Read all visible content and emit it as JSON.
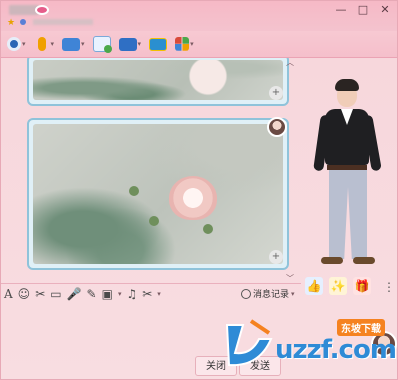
{
  "titlebar": {
    "controls": [
      "—",
      "□",
      "✕"
    ]
  },
  "toolbar": {
    "items": [
      {
        "icon": "record-icon",
        "color": "#2a66b5"
      },
      {
        "icon": "microphone-icon",
        "color": "#f0a000"
      },
      {
        "icon": "folder-icon",
        "color": "#3f84d6"
      },
      {
        "icon": "add-app-icon",
        "color": "#4aa84a"
      },
      {
        "icon": "screen-share-icon",
        "color": "#2f6fc4"
      },
      {
        "icon": "remote-desktop-icon",
        "color": "#2a8fd0"
      },
      {
        "icon": "apps-grid-icon",
        "color": "#d84a3a"
      }
    ]
  },
  "chat": {
    "zoom_glyph": "+"
  },
  "inputbar": {
    "icons": [
      "A",
      "☺",
      "✂",
      "▭",
      "🎤",
      "✎",
      "▣",
      "♫",
      "✂"
    ],
    "history_label": "消息记录"
  },
  "bottom": {
    "close_label": "关闭",
    "send_label": "发送"
  },
  "actions": {
    "icons": [
      "👍",
      "✨",
      "🎁"
    ],
    "more": "⋮"
  },
  "watermark": {
    "text": "uzzf.com",
    "badge": "东坡下载"
  },
  "colors": {
    "window_bg": "#f8dde1",
    "frame_border": "#8fc3da",
    "watermark_blue": "#2e8bd6",
    "watermark_orange": "#f58220"
  }
}
